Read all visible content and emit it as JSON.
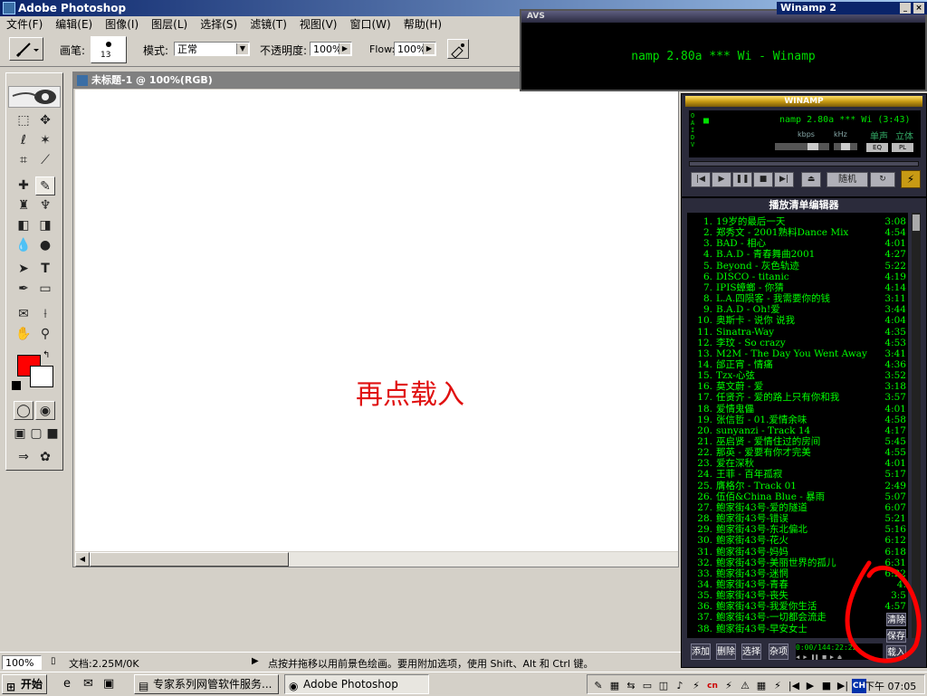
{
  "photoshop": {
    "window_title": "Adobe Photoshop",
    "menu": [
      "文件(F)",
      "编辑(E)",
      "图像(I)",
      "图层(L)",
      "选择(S)",
      "滤镜(T)",
      "视图(V)",
      "窗口(W)",
      "帮助(H)"
    ],
    "options": {
      "brush_label": "画笔:",
      "brush_size": "13",
      "mode_label": "模式:",
      "mode_value": "正常",
      "opacity_label": "不透明度:",
      "opacity_value": "100%",
      "flow_label": "Flow:",
      "flow_value": "100%"
    },
    "document": {
      "title": "未标题-1 @ 100%(RGB)",
      "canvas_text": "再点载入"
    },
    "status": {
      "zoom": "100%",
      "doc_size": "文档:2.25M/0K",
      "hint": "点按并拖移以用前景色绘画。要用附加选项，使用 Shift、Alt 和 Ctrl 键。"
    },
    "colors": {
      "foreground": "#ff0000",
      "background": "#ffffff"
    }
  },
  "avs": {
    "title": "AVS",
    "text": "namp 2.80a *** Wi - Winamp"
  },
  "winamp_titlebar": "Winamp 2",
  "winamp": {
    "title": "WINAMP",
    "track_display": "namp 2.80a *** Wi (3:43)",
    "kbps_label": "kbps",
    "khz_label": "kHz",
    "stereo_label": "单声",
    "stereo2_label": "立体",
    "eq_label": "EQ",
    "pl_label": "PL",
    "shuffle_label": "随机"
  },
  "playlist": {
    "title": "播放清单编辑器",
    "items": [
      {
        "num": "1.",
        "title": "19岁的最后一天",
        "dur": "3:08"
      },
      {
        "num": "2.",
        "title": "郑秀文 - 2001熟料Dance Mix",
        "dur": "4:54"
      },
      {
        "num": "3.",
        "title": "BAD - 相心",
        "dur": "4:01"
      },
      {
        "num": "4.",
        "title": "B.A.D - 青春舞曲2001",
        "dur": "4:27"
      },
      {
        "num": "5.",
        "title": "Beyond - 灰色轨迹",
        "dur": "5:22"
      },
      {
        "num": "6.",
        "title": "DISCO - titanic",
        "dur": "4:19"
      },
      {
        "num": "7.",
        "title": "IPIS蟑螂 - 你猜",
        "dur": "4:14"
      },
      {
        "num": "8.",
        "title": "L.A.四陨客 - 我需要你的钱",
        "dur": "3:11"
      },
      {
        "num": "9.",
        "title": "B.A.D - Oh!爱",
        "dur": "3:44"
      },
      {
        "num": "10.",
        "title": "奥斯卡 - 说你 说我",
        "dur": "4:04"
      },
      {
        "num": "11.",
        "title": "Sinatra-Way",
        "dur": "4:35"
      },
      {
        "num": "12.",
        "title": "李玟 - So crazy",
        "dur": "4:53"
      },
      {
        "num": "13.",
        "title": "M2M - The Day You Went Away",
        "dur": "3:41"
      },
      {
        "num": "14.",
        "title": "邰正宵 - 情痛",
        "dur": "4:36"
      },
      {
        "num": "15.",
        "title": "Tzx-心弦",
        "dur": "3:52"
      },
      {
        "num": "16.",
        "title": "莫文蔚 - 爱",
        "dur": "3:18"
      },
      {
        "num": "17.",
        "title": "任贤齐 - 爱的路上只有你和我",
        "dur": "3:57"
      },
      {
        "num": "18.",
        "title": "爱情鬼儡",
        "dur": "4:01"
      },
      {
        "num": "19.",
        "title": "张信哲 - 01.爱情余味",
        "dur": "4:58"
      },
      {
        "num": "20.",
        "title": "sunyanzi - Track 14",
        "dur": "4:17"
      },
      {
        "num": "21.",
        "title": "巫启贤 - 爱情住过的房间",
        "dur": "5:45"
      },
      {
        "num": "22.",
        "title": "那英 - 爱要有你才完美",
        "dur": "4:55"
      },
      {
        "num": "23.",
        "title": "爱在深秋",
        "dur": "4:01"
      },
      {
        "num": "24.",
        "title": "王菲 - 百年孤寂",
        "dur": "5:17"
      },
      {
        "num": "25.",
        "title": "膺格尔 - Track 01",
        "dur": "2:49"
      },
      {
        "num": "26.",
        "title": "伍佰&China Blue - 暴雨",
        "dur": "5:07"
      },
      {
        "num": "27.",
        "title": "鲍家街43号-爱的隧道",
        "dur": "6:07"
      },
      {
        "num": "28.",
        "title": "鲍家街43号-错误",
        "dur": "5:21"
      },
      {
        "num": "29.",
        "title": "鲍家街43号-东北偏北",
        "dur": "5:16"
      },
      {
        "num": "30.",
        "title": "鲍家街43号-花火",
        "dur": "6:12"
      },
      {
        "num": "31.",
        "title": "鲍家街43号-妈妈",
        "dur": "6:18"
      },
      {
        "num": "32.",
        "title": "鲍家街43号-美丽世界的孤儿",
        "dur": "6:31"
      },
      {
        "num": "33.",
        "title": "鲍家街43号-迷惘",
        "dur": "6:22"
      },
      {
        "num": "34.",
        "title": "鲍家街43号-青春",
        "dur": "4:"
      },
      {
        "num": "35.",
        "title": "鲍家街43号-丧失",
        "dur": "3:5"
      },
      {
        "num": "36.",
        "title": "鲍家街43号-我爱你生活",
        "dur": "4:57"
      },
      {
        "num": "37.",
        "title": "鲍家街43号-一切都会流走",
        "dur": ""
      },
      {
        "num": "38.",
        "title": "鲍家街43号-早安女士",
        "dur": ""
      }
    ],
    "buttons": {
      "add": "添加",
      "remove": "删除",
      "select": "选择",
      "misc": "杂项",
      "clear": "清除",
      "save": "保存",
      "load": "载入"
    },
    "time_display": "0:00/144:22:22"
  },
  "taskbar": {
    "start": "开始",
    "task1": "专家系列网管软件服务...",
    "task2": "Adobe Photoshop",
    "clock": "下午 07:05",
    "ime": "CH"
  },
  "accent_colors": {
    "annotation_red": "#ff0000",
    "winamp_green": "#00ff00"
  }
}
